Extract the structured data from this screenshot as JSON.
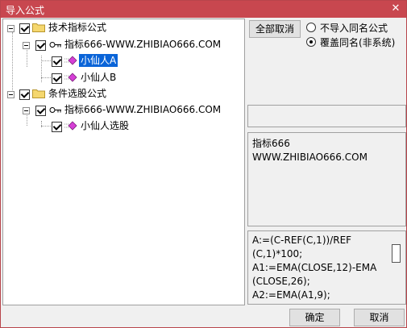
{
  "window": {
    "title": "导入公式",
    "close_glyph": "✕"
  },
  "tree": {
    "nodes": [
      {
        "label": "技术指标公式"
      },
      {
        "label": "指标666-WWW.ZHIBIAO666.COM"
      },
      {
        "label": "小仙人A"
      },
      {
        "label": "小仙人B"
      },
      {
        "label": "条件选股公式"
      },
      {
        "label": "指标666-WWW.ZHIBIAO666.COM"
      },
      {
        "label": "小仙人选股"
      }
    ]
  },
  "options": {
    "cancel_all": "全部取消",
    "radio_no_import": "不导入同名公式",
    "radio_overwrite": "覆盖同名(非系统)",
    "selected": "radio_overwrite"
  },
  "description": {
    "line1": "指标666",
    "line2": "WWW.ZHIBIAO666.COM"
  },
  "formula": {
    "lines": [
      "A:=(C-REF(C,1))/REF",
      "(C,1)*100;",
      "A1:=EMA(CLOSE,12)-EMA",
      "(CLOSE,26);",
      "A2:=EMA(A1,9);"
    ]
  },
  "buttons": {
    "ok": "确定",
    "cancel": "取消"
  },
  "colors": {
    "titlebar": "#c8474f",
    "selection": "#0a64d8",
    "folder": "#f5d76e",
    "diamond": "#d63fd6"
  },
  "icons": {
    "folder": "folder-icon",
    "key": "key-icon",
    "formula": "formula-diamond-icon"
  }
}
